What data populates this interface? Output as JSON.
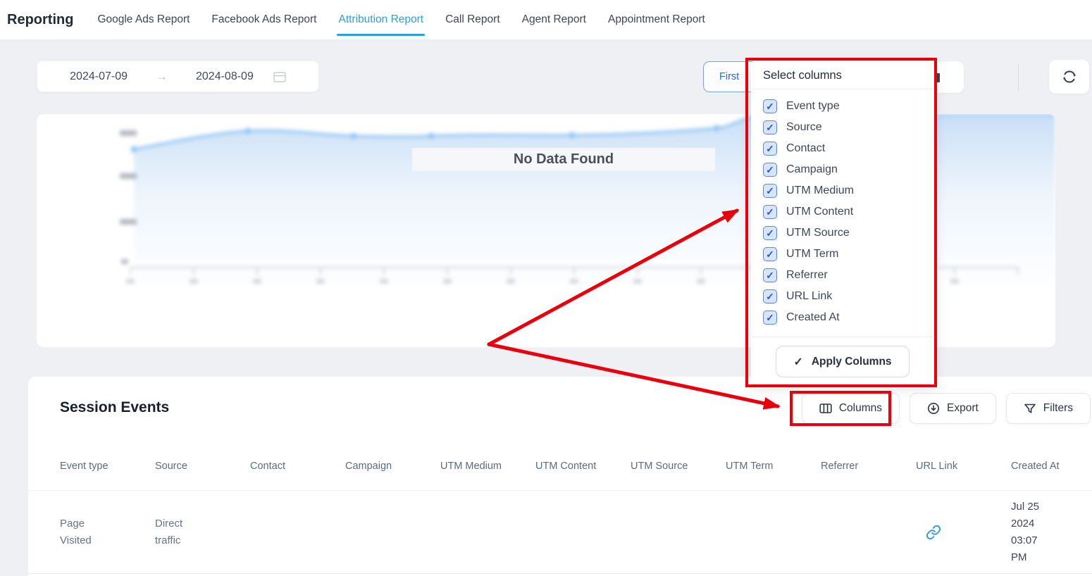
{
  "nav": {
    "title": "Reporting",
    "tabs": [
      {
        "label": "Google Ads Report",
        "active": false
      },
      {
        "label": "Facebook Ads Report",
        "active": false
      },
      {
        "label": "Attribution Report",
        "active": true
      },
      {
        "label": "Call Report",
        "active": false
      },
      {
        "label": "Agent Report",
        "active": false
      },
      {
        "label": "Appointment Report",
        "active": false
      }
    ]
  },
  "toolbar": {
    "date_start": "2024-07-09",
    "date_end": "2024-08-09",
    "touch_label": "First"
  },
  "icons": {
    "arrow_right": "→",
    "check": "✓"
  },
  "chart": {
    "no_data_text": "No Data Found"
  },
  "columns_dropdown": {
    "title": "Select columns",
    "options": [
      {
        "label": "Event type",
        "checked": true
      },
      {
        "label": "Source",
        "checked": true
      },
      {
        "label": "Contact",
        "checked": true
      },
      {
        "label": "Campaign",
        "checked": true
      },
      {
        "label": "UTM Medium",
        "checked": true
      },
      {
        "label": "UTM Content",
        "checked": true
      },
      {
        "label": "UTM Source",
        "checked": true
      },
      {
        "label": "UTM Term",
        "checked": true
      },
      {
        "label": "Referrer",
        "checked": true
      },
      {
        "label": "URL Link",
        "checked": true
      },
      {
        "label": "Created At",
        "checked": true
      }
    ],
    "apply_label": "Apply Columns"
  },
  "session_events": {
    "title": "Session Events",
    "buttons": {
      "columns": "Columns",
      "export": "Export",
      "filters": "Filters"
    },
    "table": {
      "headers": [
        "Event type",
        "Source",
        "Contact",
        "Campaign",
        "UTM Medium",
        "UTM Content",
        "UTM Source",
        "UTM Term",
        "Referrer",
        "URL Link",
        "Created At"
      ],
      "rows": [
        {
          "event_type": "Page Visited",
          "source": "Direct traffic",
          "contact": "",
          "campaign": "",
          "utm_medium": "",
          "utm_content": "",
          "utm_source": "",
          "utm_term": "",
          "referrer": "",
          "url_link": "link-icon",
          "created_at": "Jul 25 2024 03:07 PM"
        }
      ]
    }
  },
  "colors": {
    "active_tab_blue": "#2ba0dd",
    "checkbox_blue": "#5b85e8",
    "checkbox_fill": "#d7e5fc",
    "annotation_red": "#e8000d",
    "link_blue": "#3b9ddd",
    "chart_line_blue": "#8fc4f2"
  }
}
